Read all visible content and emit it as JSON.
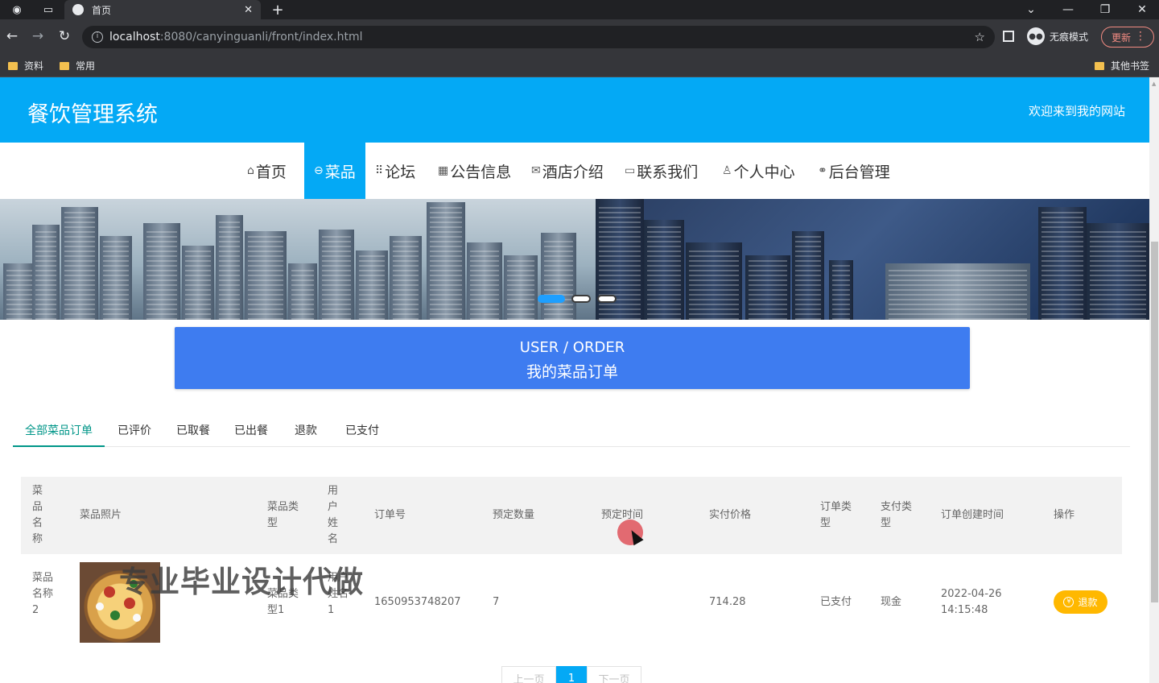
{
  "browser": {
    "tab_title": "首页",
    "url_host": "localhost",
    "url_path": ":8080/canyinguanli/front/index.html",
    "incognito_label": "无痕模式",
    "update_label": "更新",
    "bookmarks": [
      "资料",
      "常用"
    ],
    "other_bookmarks": "其他书签"
  },
  "site": {
    "title": "餐饮管理系统",
    "welcome": "欢迎来到我的网站",
    "header_color": "#04a9f5"
  },
  "nav": {
    "items": [
      {
        "icon": "home-icon",
        "label": "首页"
      },
      {
        "icon": "dish-icon",
        "label": "菜品"
      },
      {
        "icon": "forum-icon",
        "label": "论坛"
      },
      {
        "icon": "notice-icon",
        "label": "公告信息"
      },
      {
        "icon": "mail-icon",
        "label": "酒店介绍"
      },
      {
        "icon": "contact-icon",
        "label": "联系我们"
      },
      {
        "icon": "user-icon",
        "label": "个人中心"
      },
      {
        "icon": "link-icon",
        "label": "后台管理"
      }
    ],
    "active_index": 1
  },
  "banner": {
    "active_dot": 0,
    "dot_count": 3
  },
  "order_header": {
    "title_en": "USER / ORDER",
    "title_cn": "我的菜品订单"
  },
  "tabs": [
    "全部菜品订单",
    "已评价",
    "已取餐",
    "已出餐",
    "退款",
    "已支付"
  ],
  "table": {
    "headers": {
      "dish_name": "菜品名称",
      "photo": "菜品照片",
      "dish_type": "菜品类型",
      "user_name": "用户姓名",
      "order_no": "订单号",
      "qty": "预定数量",
      "time": "预定时间",
      "price": "实付价格",
      "order_type": "订单类型",
      "pay_type": "支付类型",
      "created": "订单创建时间",
      "action": "操作"
    },
    "rows": [
      {
        "dish_name": "菜品名称2",
        "dish_type": "菜品类型1",
        "user_name": "用户姓名1",
        "order_no": "1650953748207",
        "qty": "7",
        "time": "",
        "price": "714.28",
        "order_type": "已支付",
        "pay_type": "现金",
        "created_date": "2022-04-26",
        "created_time": "14:15:48",
        "action_label": "退款"
      }
    ]
  },
  "watermark": "专业毕业设计代做",
  "pagination": {
    "prev": "上一页",
    "current": "1",
    "next": "下一页"
  }
}
